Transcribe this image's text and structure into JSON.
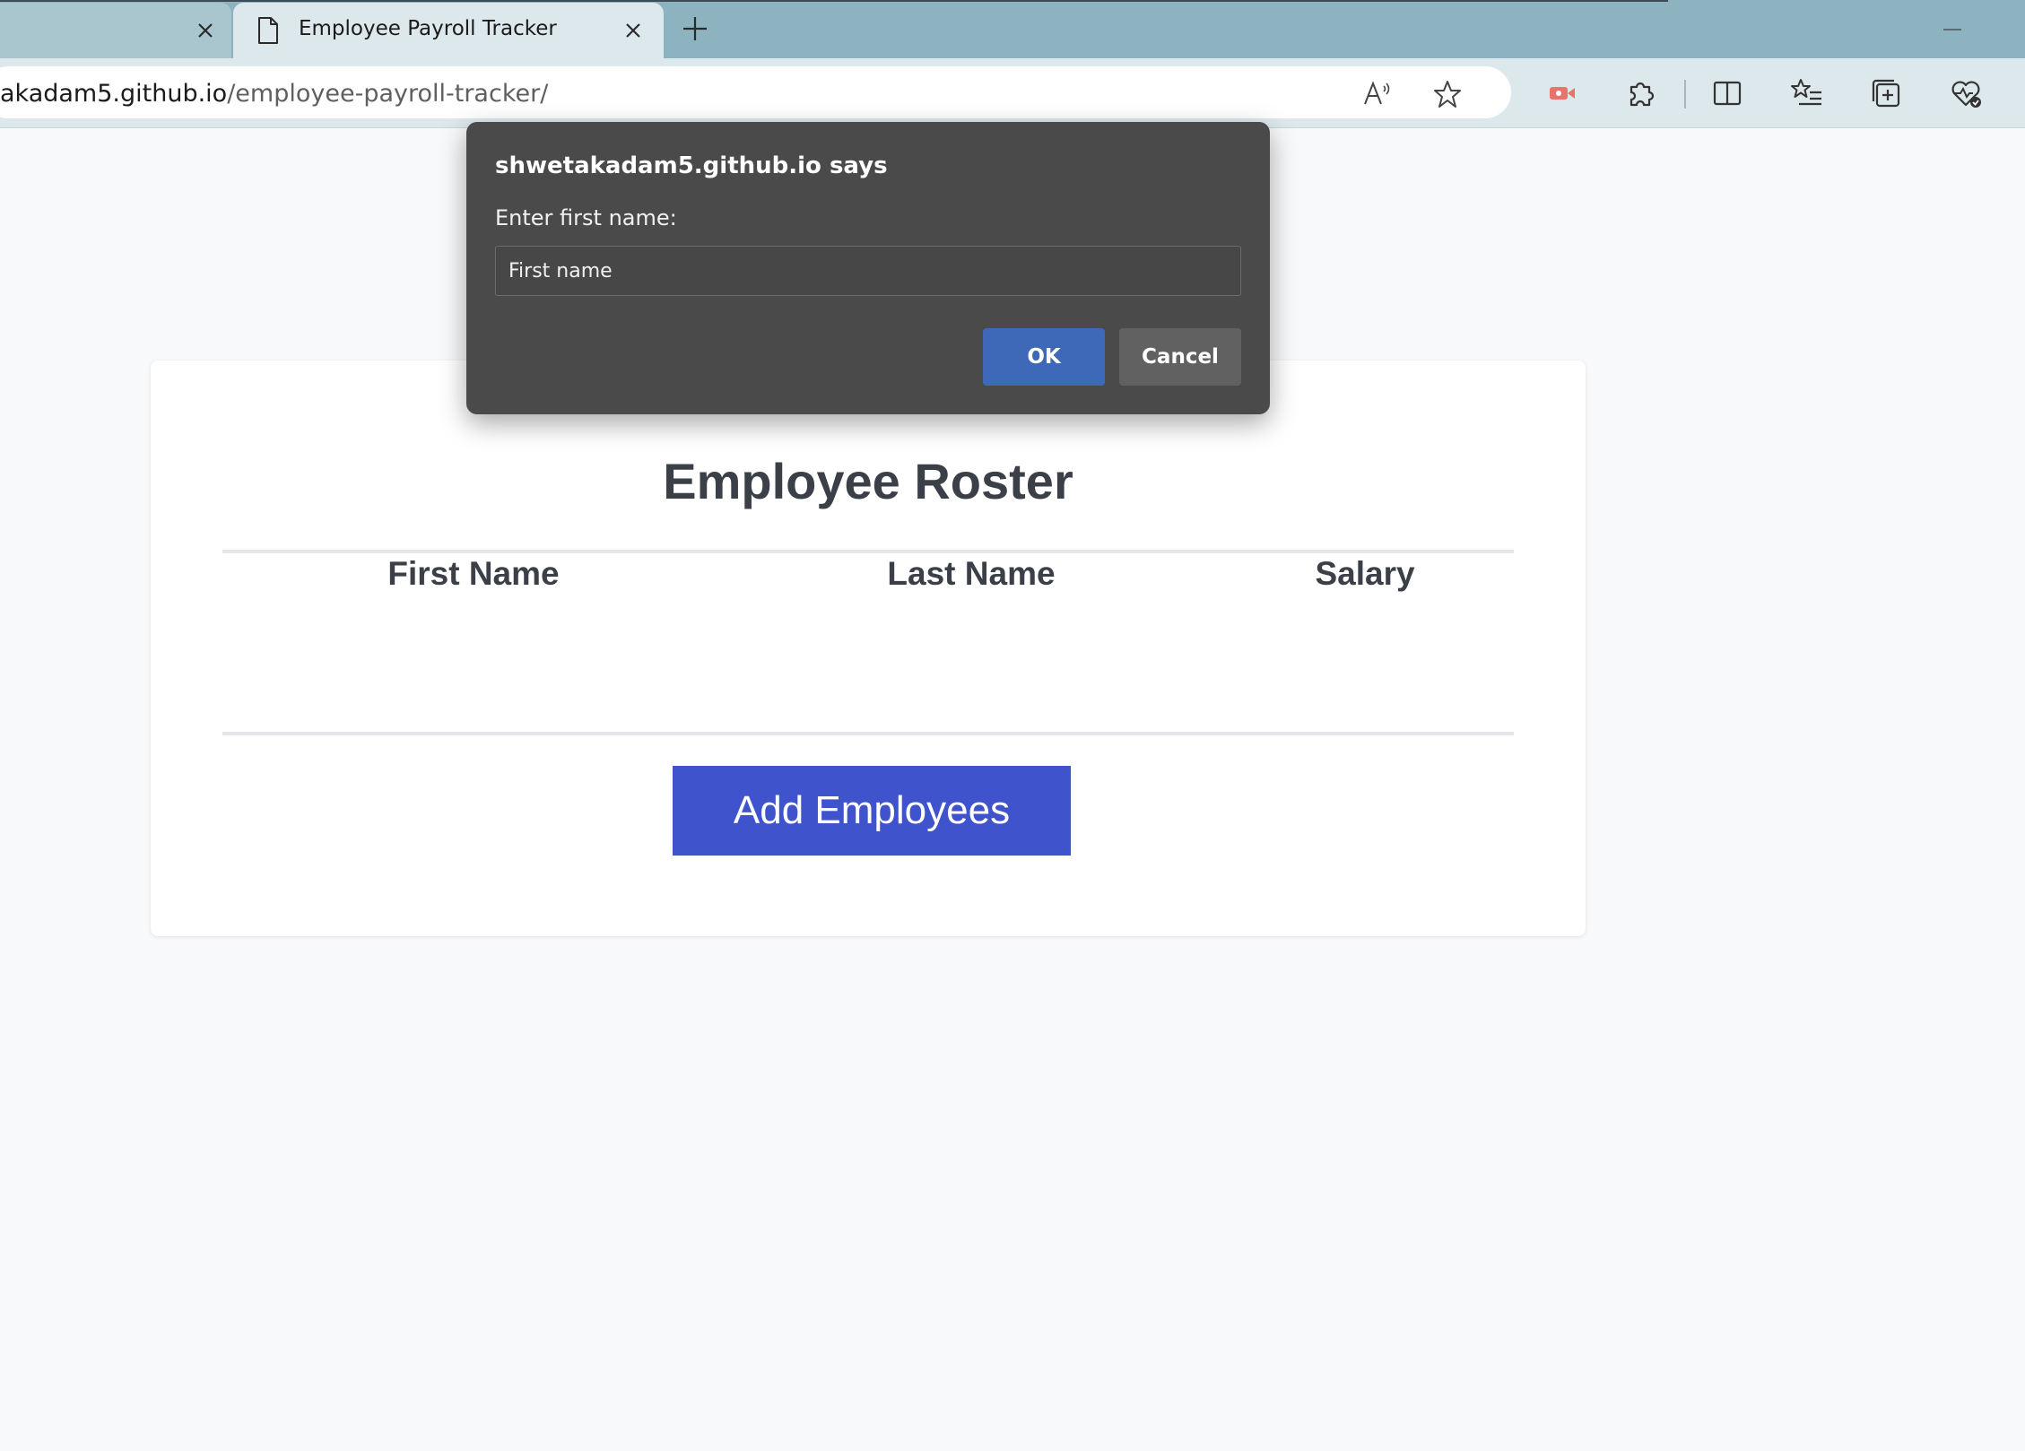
{
  "browser": {
    "tabs": [
      {
        "label": "",
        "active": false
      },
      {
        "label": "Employee Payroll Tracker",
        "active": true
      }
    ],
    "url_host": "akadam5.github.io",
    "url_path": "/employee-payroll-tracker/"
  },
  "page": {
    "title": "Employee Roster",
    "columns": [
      "First Name",
      "Last Name",
      "Salary"
    ],
    "add_button_label": "Add Employees"
  },
  "dialog": {
    "title": "shwetakadam5.github.io says",
    "message": "Enter first name:",
    "input_value": "First name",
    "ok_label": "OK",
    "cancel_label": "Cancel"
  },
  "colors": {
    "tab_strip": "#8cb3bf",
    "toolbar": "#dde8ed",
    "add_button": "#3f53cc",
    "dialog_bg": "#4a4a4a",
    "dialog_ok": "#3d69b8"
  }
}
